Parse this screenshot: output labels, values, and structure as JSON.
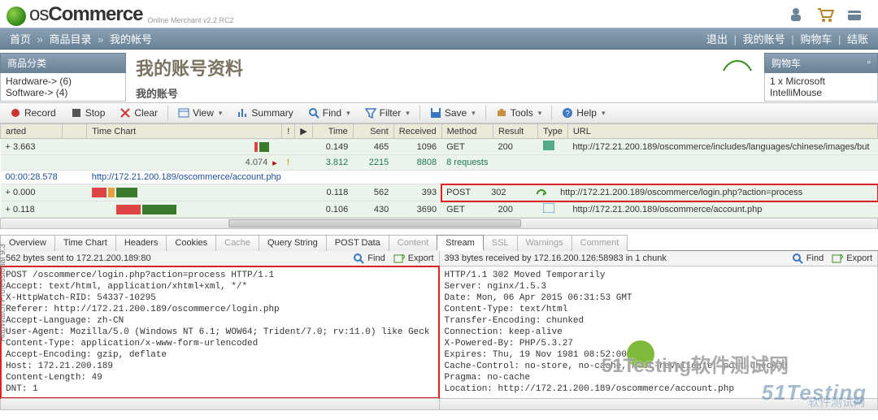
{
  "osc": {
    "logo_prefix": "os",
    "logo_bold": "Commerce",
    "logo_sub": "Online Merchant v2.2 RC2",
    "nav_left": [
      "首页",
      "商品目录",
      "我的帐号"
    ],
    "nav_right": [
      "退出",
      "我的账号",
      "购物车",
      "结账"
    ],
    "cat_title": "商品分类",
    "cats": [
      "Hardware-> (6)",
      "Software-> (4)"
    ],
    "page_title": "我的账号资料",
    "page_sub": "我的账号",
    "cart_title": "购物车",
    "cart_item": "1 x Microsoft IntelliMouse"
  },
  "toolbar": {
    "record": "Record",
    "stop": "Stop",
    "clear": "Clear",
    "view": "View",
    "summary": "Summary",
    "find": "Find",
    "filter": "Filter",
    "save": "Save",
    "tools": "Tools",
    "help": "Help"
  },
  "grid": {
    "cols": [
      "arted",
      "",
      "Time Chart",
      "!",
      "▶",
      "Time",
      "Sent",
      "Received",
      "Method",
      "Result",
      "Type",
      "URL"
    ],
    "r1": {
      "arted": "+ 3.663",
      "time": "0.149",
      "sent": "465",
      "recv": "1096",
      "method": "GET",
      "result": "200",
      "url": "http://172.21.200.189/oscommerce/includes/languages/chinese/images/but"
    },
    "r2": {
      "arted": "",
      "tc_label": "4.074",
      "time": "3.812",
      "sent": "2215",
      "recv": "8808",
      "method": "8 requests",
      "result": "",
      "url": ""
    },
    "r3": {
      "arted": "00:00:28.578",
      "url": "http://172.21.200.189/oscommerce/account.php"
    },
    "r4": {
      "arted": "+ 0.000",
      "time": "0.118",
      "sent": "562",
      "recv": "393",
      "method": "POST",
      "result": "302",
      "url": "http://172.21.200.189/oscommerce/login.php?action=process"
    },
    "r5": {
      "arted": "+ 0.118",
      "time": "0.106",
      "sent": "430",
      "recv": "3690",
      "method": "GET",
      "result": "200",
      "url": "http://172.21.200.189/oscommerce/account.php"
    }
  },
  "tabs": [
    "Overview",
    "Time Chart",
    "Headers",
    "Cookies",
    "Cache",
    "Query String",
    "POST Data",
    "Content",
    "Stream",
    "SSL",
    "Warnings",
    "Comment"
  ],
  "active_tab": "Stream",
  "disabled_tabs": [
    "Cache",
    "Content",
    "SSL",
    "Warnings",
    "Comment"
  ],
  "left_pane": {
    "head": "562 bytes sent to 172.21.200.189:80",
    "find": "Find",
    "export": "Export",
    "body": "POST /oscommerce/login.php?action=process HTTP/1.1\nAccept: text/html, application/xhtml+xml, */*\nX-HttpWatch-RID: 54337-10295\nReferer: http://172.21.200.189/oscommerce/login.php\nAccept-Language: zh-CN\nUser-Agent: Mozilla/5.0 (Windows NT 6.1; WOW64; Trident/7.0; rv:11.0) like Geck\nContent-Type: application/x-www-form-urlencoded\nAccept-Encoding: gzip, deflate\nHost: 172.21.200.189\nContent-Length: 49\nDNT: 1"
  },
  "right_pane": {
    "head": "393 bytes received by 172.16.200.126:58983 in 1 chunk",
    "find": "Find",
    "export": "Export",
    "body": "HTTP/1.1 302 Moved Temporarily\nServer: nginx/1.5.3\nDate: Mon, 06 Apr 2015 06:31:53 GMT\nContent-Type: text/html\nTransfer-Encoding: chunked\nConnection: keep-alive\nX-Powered-By: PHP/5.3.27\nExpires: Thu, 19 Nov 1981 08:52:00 GMT\nCache-Control: no-store, no-cache, must-revalidate, post-check=0\nPragma: no-cache\nLocation: http://172.21.200.189/oscommerce/account.php"
  },
  "sidetext": "HttpWatch Professional 9.3",
  "wm1": "51Testing软件测试网",
  "wm2": "51Testing",
  "wm_sub": "软件测试网"
}
